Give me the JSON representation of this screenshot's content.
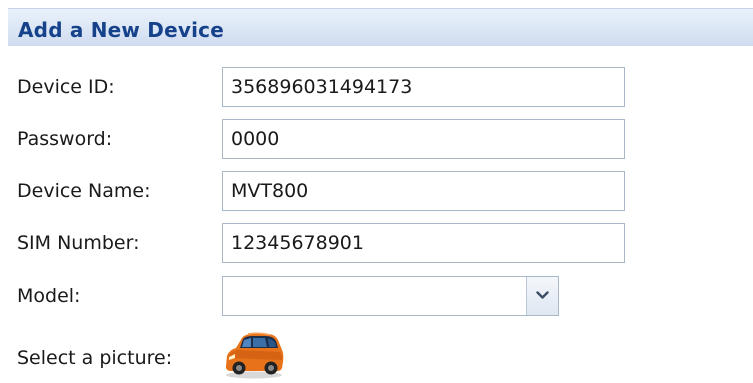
{
  "panel": {
    "title": "Add a New Device"
  },
  "form": {
    "device_id": {
      "label": "Device ID:",
      "value": "356896031494173"
    },
    "password": {
      "label": "Password:",
      "value": "0000"
    },
    "device_name": {
      "label": "Device Name:",
      "value": "MVT800"
    },
    "sim_number": {
      "label": "SIM Number:",
      "value": "12345678901"
    },
    "model": {
      "label": "Model:",
      "value": "",
      "trigger_icon": "chevron-down-icon"
    },
    "picture": {
      "label": "Select a picture:",
      "icon": "car-icon"
    }
  },
  "colors": {
    "header_text": "#15428b",
    "header_bg": "#dbe6f5",
    "field_border": "#a9b8c8",
    "car_body": "#e8721a"
  }
}
